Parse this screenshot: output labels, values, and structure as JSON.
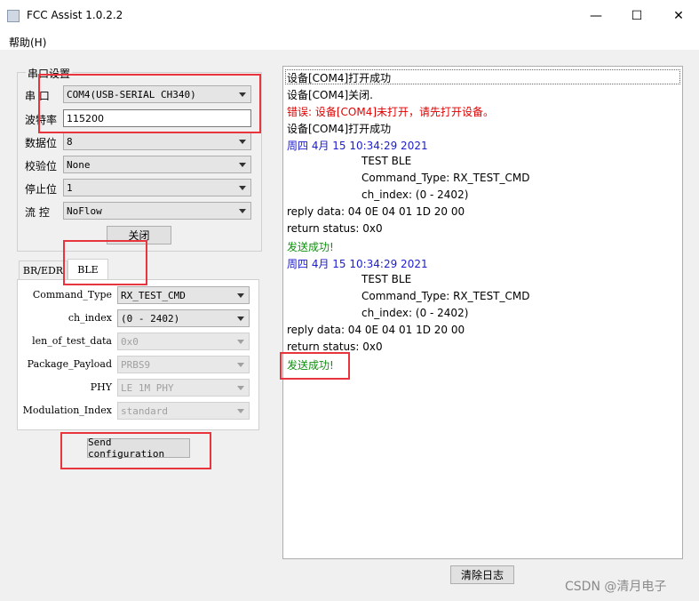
{
  "window": {
    "title": "FCC Assist 1.0.2.2",
    "minimize_glyph": "—",
    "maximize_glyph": "☐",
    "close_glyph": "✕"
  },
  "menu": {
    "help": "帮助(H)"
  },
  "serial": {
    "group_title": "串口设置",
    "port_label": "串  口",
    "port_value": "COM4(USB-SERIAL CH340)",
    "baud_label": "波特率",
    "baud_value": "115200",
    "data_bits_label": "数据位",
    "data_bits_value": "8",
    "parity_label": "校验位",
    "parity_value": "None",
    "stop_bits_label": "停止位",
    "stop_bits_value": "1",
    "flow_label": "流  控",
    "flow_value": "NoFlow",
    "close_button": "关闭"
  },
  "tabs": [
    {
      "label": "BR/EDR"
    },
    {
      "label": "BLE"
    }
  ],
  "ble": {
    "fields": [
      {
        "label": "Command_Type",
        "value": "RX_TEST_CMD",
        "enabled": true
      },
      {
        "label": "ch_index",
        "value": "(0 - 2402)",
        "enabled": true
      },
      {
        "label": "len_of_test_data",
        "value": "0x0",
        "enabled": false
      },
      {
        "label": "Package_Payload",
        "value": "PRBS9",
        "enabled": false
      },
      {
        "label": "PHY",
        "value": "LE 1M PHY",
        "enabled": false
      },
      {
        "label": "Modulation_Index",
        "value": "standard",
        "enabled": false
      }
    ],
    "send_button": "Send configuration"
  },
  "log": {
    "lines": [
      {
        "text": "设备[COM4]打开成功",
        "color": "black",
        "indent": false
      },
      {
        "text": "设备[COM4]关闭.",
        "color": "black",
        "indent": false
      },
      {
        "text": "错误: 设备[COM4]未打开，请先打开设备。",
        "color": "red",
        "indent": false
      },
      {
        "text": "设备[COM4]打开成功",
        "color": "black",
        "indent": false
      },
      {
        "text": "周四 4月 15 10:34:29 2021",
        "color": "blue",
        "indent": false
      },
      {
        "text": "TEST BLE",
        "color": "black",
        "indent": true
      },
      {
        "text": "Command_Type: RX_TEST_CMD",
        "color": "black",
        "indent": true
      },
      {
        "text": "ch_index: (0 - 2402)",
        "color": "black",
        "indent": true
      },
      {
        "text": "reply data: 04 0E 04 01 1D 20 00",
        "color": "black",
        "indent": false
      },
      {
        "text": "return status: 0x0",
        "color": "black",
        "indent": false
      },
      {
        "text": "发送成功!",
        "color": "green",
        "indent": false
      },
      {
        "text": "周四 4月 15 10:34:29 2021",
        "color": "blue",
        "indent": false
      },
      {
        "text": "TEST BLE",
        "color": "black",
        "indent": true
      },
      {
        "text": "Command_Type: RX_TEST_CMD",
        "color": "black",
        "indent": true
      },
      {
        "text": "ch_index: (0 - 2402)",
        "color": "black",
        "indent": true
      },
      {
        "text": "reply data: 04 0E 04 01 1D 20 00",
        "color": "black",
        "indent": false
      },
      {
        "text": "return status: 0x0",
        "color": "black",
        "indent": false
      },
      {
        "text": "发送成功!",
        "color": "green",
        "indent": false
      }
    ],
    "clear_button": "清除日志"
  },
  "watermark": "CSDN @清月电子"
}
